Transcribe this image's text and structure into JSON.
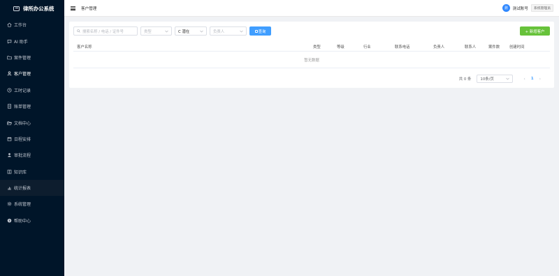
{
  "app": {
    "title": "律所办公系统"
  },
  "sidebar": {
    "items": [
      {
        "label": "工作台",
        "icon": "home-icon"
      },
      {
        "label": "AI 助手",
        "icon": "chat-icon"
      },
      {
        "label": "案件管理",
        "icon": "folder-icon"
      },
      {
        "label": "客户管理",
        "icon": "user-icon"
      },
      {
        "label": "工时记录",
        "icon": "clock-icon"
      },
      {
        "label": "账单管理",
        "icon": "document-icon"
      },
      {
        "label": "文档中心",
        "icon": "folder-open-icon"
      },
      {
        "label": "日程安排",
        "icon": "calendar-icon"
      },
      {
        "label": "审批流程",
        "icon": "person-icon"
      },
      {
        "label": "知识库",
        "icon": "book-icon"
      },
      {
        "label": "统计报表",
        "icon": "chart-icon"
      },
      {
        "label": "系统管理",
        "icon": "gear-icon"
      },
      {
        "label": "帮助中心",
        "icon": "help-icon"
      }
    ]
  },
  "header": {
    "page_title": "客户管理",
    "user": {
      "avatar_text": "测",
      "name": "测试账号",
      "role": "系统管理员"
    }
  },
  "filters": {
    "search_placeholder": "搜索名称 / 电话 / 证件号",
    "type_placeholder": "类型",
    "status_value": "C 潜在",
    "owner_placeholder": "负责人",
    "query_label": "查询"
  },
  "actions": {
    "new_customer_label": "+ 新增客户"
  },
  "table": {
    "columns": [
      "客户名称",
      "类型",
      "等级",
      "行业",
      "联系电话",
      "负责人",
      "联系人",
      "案件数",
      "创建时间"
    ],
    "empty_text": "暂无数据"
  },
  "pagination": {
    "total_text": "共 0 条",
    "page_size": "10条/页",
    "prev": "‹",
    "current_page": "1",
    "next": "›"
  },
  "colors": {
    "sidebar_bg": "#001529",
    "primary": "#409eff",
    "success": "#67c23a",
    "avatar": "#2f88ff"
  }
}
